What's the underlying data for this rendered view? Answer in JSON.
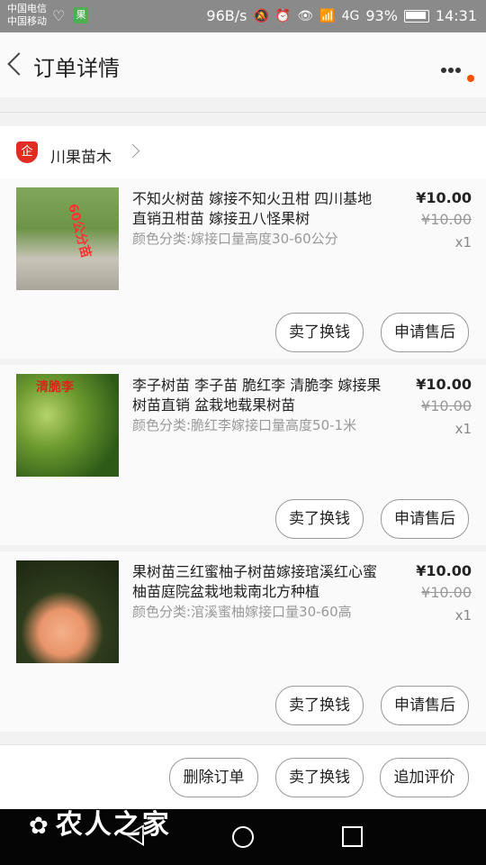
{
  "status_bar": {
    "carrier1": "中国电信",
    "carrier2": "中国移动",
    "app_badge": "果",
    "speed": "96B/s",
    "signal": "4G",
    "battery": "93%",
    "time": "14:31"
  },
  "header": {
    "title": "订单详情",
    "notification_color": "#ff5000"
  },
  "shop": {
    "name": "川果苗木",
    "icon_text": "企"
  },
  "items": [
    {
      "title": "不知火树苗 嫁接不知火丑柑 四川基地直销丑柑苗 嫁接丑八怪果树",
      "spec": "颜色分类:嫁接口量高度30-60公分",
      "price": "¥10.00",
      "original_price": "¥10.00",
      "quantity": "x1",
      "image_label": "60公分苗",
      "btn_sell": "卖了换钱",
      "btn_after_sale": "申请售后"
    },
    {
      "title": "李子树苗 李子苗 脆红李 清脆李 嫁接果树苗直销 盆栽地载果树苗",
      "spec": "颜色分类:脆红李嫁接口量高度50-1米",
      "price": "¥10.00",
      "original_price": "¥10.00",
      "quantity": "x1",
      "image_label": "清脆李",
      "btn_sell": "卖了换钱",
      "btn_after_sale": "申请售后"
    },
    {
      "title": "果树苗三红蜜柚子树苗嫁接琯溪红心蜜柚苗庭院盆栽地栽南北方种植",
      "spec": "颜色分类:涫溪蜜柚嫁接口量30-60高",
      "price": "¥10.00",
      "original_price": "¥10.00",
      "quantity": "x1",
      "image_label": "",
      "btn_sell": "卖了换钱",
      "btn_after_sale": "申请售后"
    }
  ],
  "footer": {
    "delete_order": "删除订单",
    "sell": "卖了换钱",
    "add_review": "追加评价"
  },
  "watermark": "农人之家"
}
